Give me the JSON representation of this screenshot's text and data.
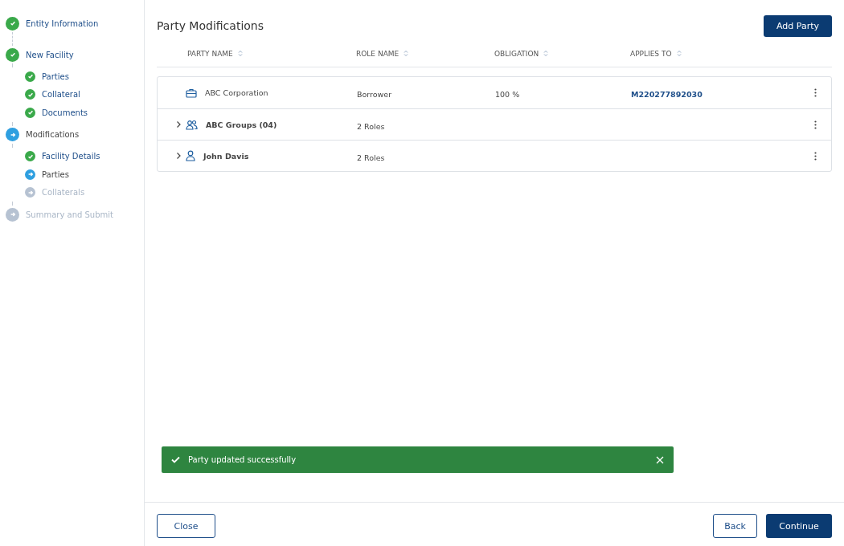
{
  "stepper": [
    {
      "label": "Entity Information",
      "kind": "done"
    },
    {
      "label": "New Facility",
      "kind": "done",
      "children": [
        {
          "label": "Parties",
          "kind": "done"
        },
        {
          "label": "Collateral",
          "kind": "done"
        },
        {
          "label": "Documents",
          "kind": "done"
        }
      ]
    },
    {
      "label": "Modifications",
      "kind": "current",
      "children": [
        {
          "label": "Facility Details",
          "kind": "done"
        },
        {
          "label": "Parties",
          "kind": "current"
        },
        {
          "label": "Collaterals",
          "kind": "pending"
        }
      ]
    },
    {
      "label": "Summary and Submit",
      "kind": "pending"
    }
  ],
  "page_title": "Party Modifications",
  "add_button": "Add Party",
  "table": {
    "columns": [
      "PARTY NAME",
      "ROLE NAME",
      "OBLIGATION",
      "APPLIES TO"
    ],
    "rows": [
      {
        "kind": "company",
        "expandable": false,
        "party_name": "ABC Corporation",
        "role_name": "Borrower",
        "obligation": "100 %",
        "applies_to": "M220277892030"
      },
      {
        "kind": "group",
        "expandable": true,
        "party_name": "ABC Groups (04)",
        "role_name": "2 Roles"
      },
      {
        "kind": "person",
        "expandable": true,
        "party_name": "John Davis",
        "role_name": "2 Roles"
      }
    ]
  },
  "toast": {
    "message": "Party updated successfully"
  },
  "footer": {
    "close": "Close",
    "back": "Back",
    "continue": "Continue"
  }
}
